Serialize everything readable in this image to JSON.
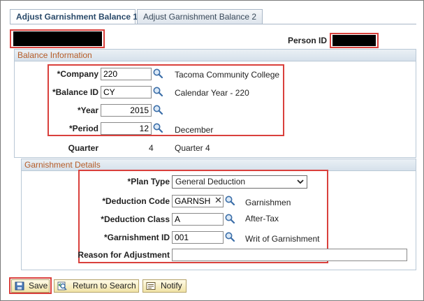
{
  "tabs": [
    {
      "label": "Adjust Garnishment Balance 1",
      "active": true
    },
    {
      "label": "Adjust Garnishment Balance 2",
      "active": false
    }
  ],
  "header": {
    "person_id_label": "Person ID"
  },
  "balance_section": {
    "title": "Balance Information",
    "company": {
      "label": "*Company",
      "value": "220",
      "description": "Tacoma Community College"
    },
    "balance_id": {
      "label": "*Balance ID",
      "value": "CY",
      "description": "Calendar Year - 220"
    },
    "year": {
      "label": "*Year",
      "value": "2015"
    },
    "period": {
      "label": "*Period",
      "value": "12",
      "description": "December"
    },
    "quarter": {
      "label": "Quarter",
      "value": "4",
      "description": "Quarter 4"
    }
  },
  "garnishment_section": {
    "title": "Garnishment Details",
    "plan_type": {
      "label": "*Plan Type",
      "value": "General Deduction"
    },
    "deduction_code": {
      "label": "*Deduction Code",
      "value": "GARNSH",
      "description": "Garnishmen"
    },
    "deduction_class": {
      "label": "*Deduction Class",
      "value": "A",
      "description": "After-Tax"
    },
    "garnishment_id": {
      "label": "*Garnishment ID",
      "value": "001",
      "description": "Writ of Garnishment"
    },
    "reason": {
      "label": "Reason for Adjustment",
      "value": ""
    }
  },
  "toolbar": {
    "save_label": "Save",
    "return_label": "Return to Search",
    "notify_label": "Notify"
  },
  "colors": {
    "highlight_box": "#d9403c",
    "section_title": "#b55b26",
    "redaction": "#000000"
  },
  "icons": [
    "lookup-magnifier-icon",
    "dropdown-arrow-icon",
    "clear-x-icon",
    "save-disk-icon",
    "return-search-icon",
    "notify-icon"
  ]
}
